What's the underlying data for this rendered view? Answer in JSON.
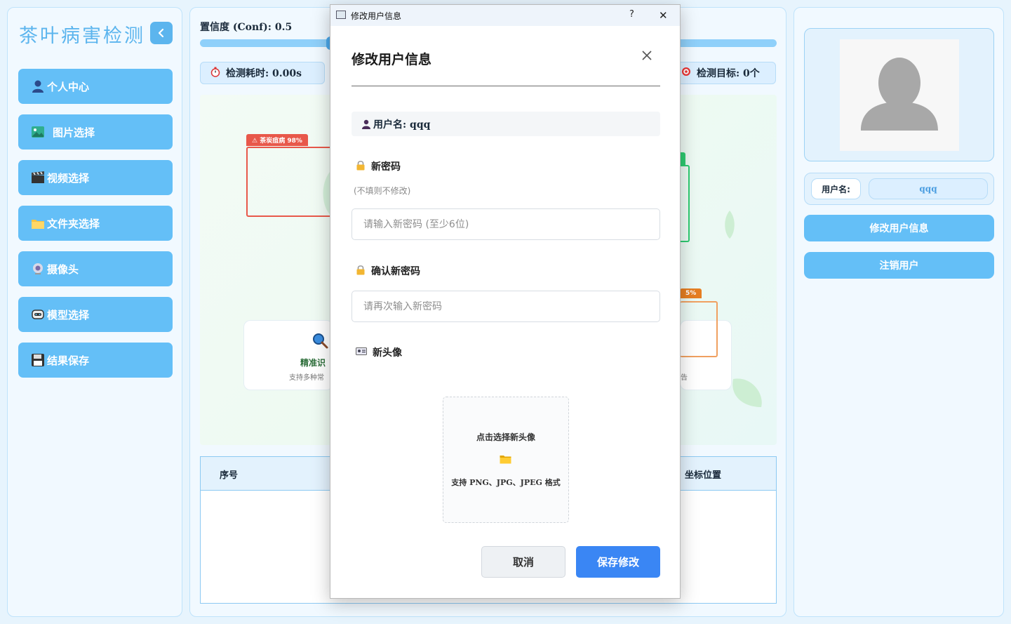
{
  "app": {
    "title": "茶叶病害检测"
  },
  "sidebar": {
    "items": [
      {
        "label": "个人中心",
        "icon": "user-icon"
      },
      {
        "label": "图片选择",
        "icon": "image-icon"
      },
      {
        "label": "视频选择",
        "icon": "clapperboard-icon"
      },
      {
        "label": "文件夹选择",
        "icon": "folder-icon"
      },
      {
        "label": "摄像头",
        "icon": "camera-icon"
      },
      {
        "label": "模型选择",
        "icon": "robot-icon"
      },
      {
        "label": "结果保存",
        "icon": "floppy-disk-icon"
      }
    ]
  },
  "main": {
    "conf_label": "置信度 (Conf): 0.5",
    "conf_value": 0.5,
    "stat_time": "检测耗时: 0.00s",
    "stat_targets": "检测目标: 0个",
    "preview": {
      "det_tag_1": "⚠ 茶炭疽病 98%",
      "det_tag_2": "5%",
      "feature_title": "精准识",
      "feature_sub": "支持多种常",
      "feature_sub_2": "告"
    },
    "table": {
      "col_index": "序号",
      "col_position": "坐标位置"
    }
  },
  "profile": {
    "username_label": "用户名:",
    "username_value": "qqq",
    "edit_button": "修改用户信息",
    "logout_button": "注销用户"
  },
  "dialog": {
    "window_title": "修改用户信息",
    "help_glyph": "?",
    "close_glyph": "✕",
    "heading": "修改用户信息",
    "username_line": "用户名: qqq",
    "new_password_label": "新密码",
    "new_password_hint": "(不填则不修改)",
    "new_password_placeholder": "请输入新密码 (至少6位)",
    "confirm_password_label": "确认新密码",
    "confirm_password_placeholder": "请再次输入新密码",
    "new_avatar_label": "新头像",
    "upload_title": "点击选择新头像",
    "upload_formats": "支持 PNG、JPG、JPEG 格式",
    "cancel_button": "取消",
    "save_button": "保存修改"
  },
  "colors": {
    "accent": "#64bff7",
    "title_blue": "#5cb5ee",
    "save_blue": "#3a86f4",
    "panel_bg": "#f1f9ff",
    "danger_tag": "#e74c3c",
    "warning_tag": "#e67e22",
    "success_tag": "#2ecc71"
  }
}
